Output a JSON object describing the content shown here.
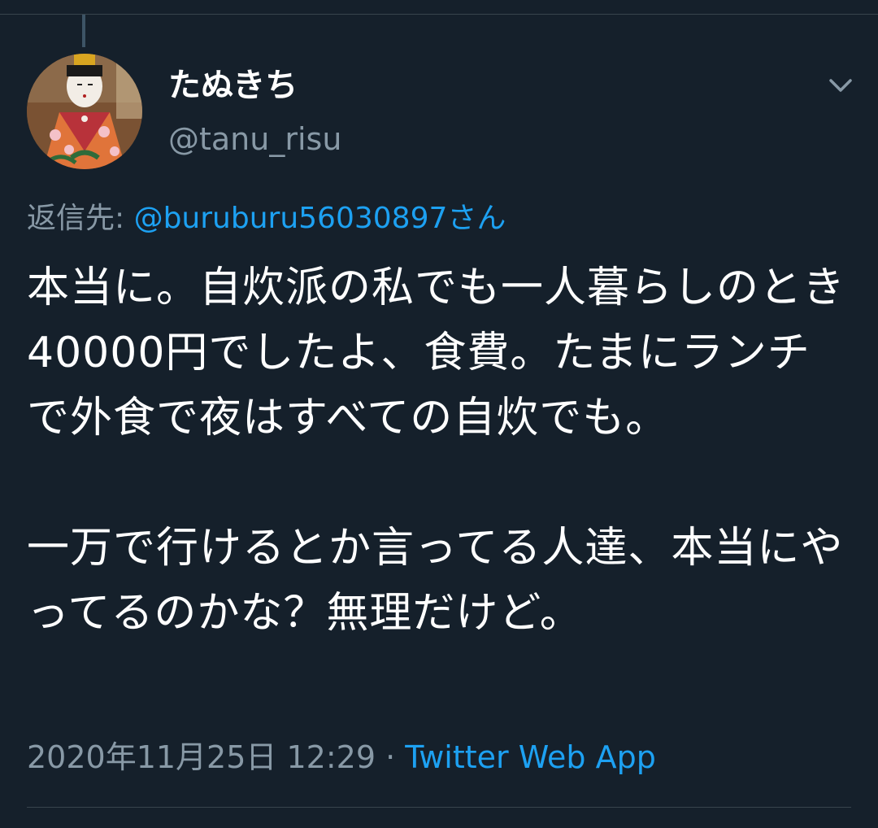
{
  "tweet": {
    "display_name": "たぬきち",
    "handle": "@tanu_risu",
    "reply_prefix": "返信先: ",
    "reply_mention": "@buruburu56030897さん",
    "text": "本当に。自炊派の私でも一人暮らしのとき40000円でしたよ、食費。たまにランチで外食で夜はすべての自炊でも。\n\n一万で行けるとか言ってる人達、本当にやってるのかな？無理だけど。",
    "timestamp": "2020年11月25日 12:29",
    "separator": " · ",
    "source": "Twitter Web App"
  },
  "icons": {
    "more": "chevron-down-icon",
    "avatar": "avatar-doll-image"
  },
  "colors": {
    "background": "#15202b",
    "text": "#ffffff",
    "muted": "#8899a6",
    "accent": "#1da1f2",
    "divider": "#38444d"
  }
}
